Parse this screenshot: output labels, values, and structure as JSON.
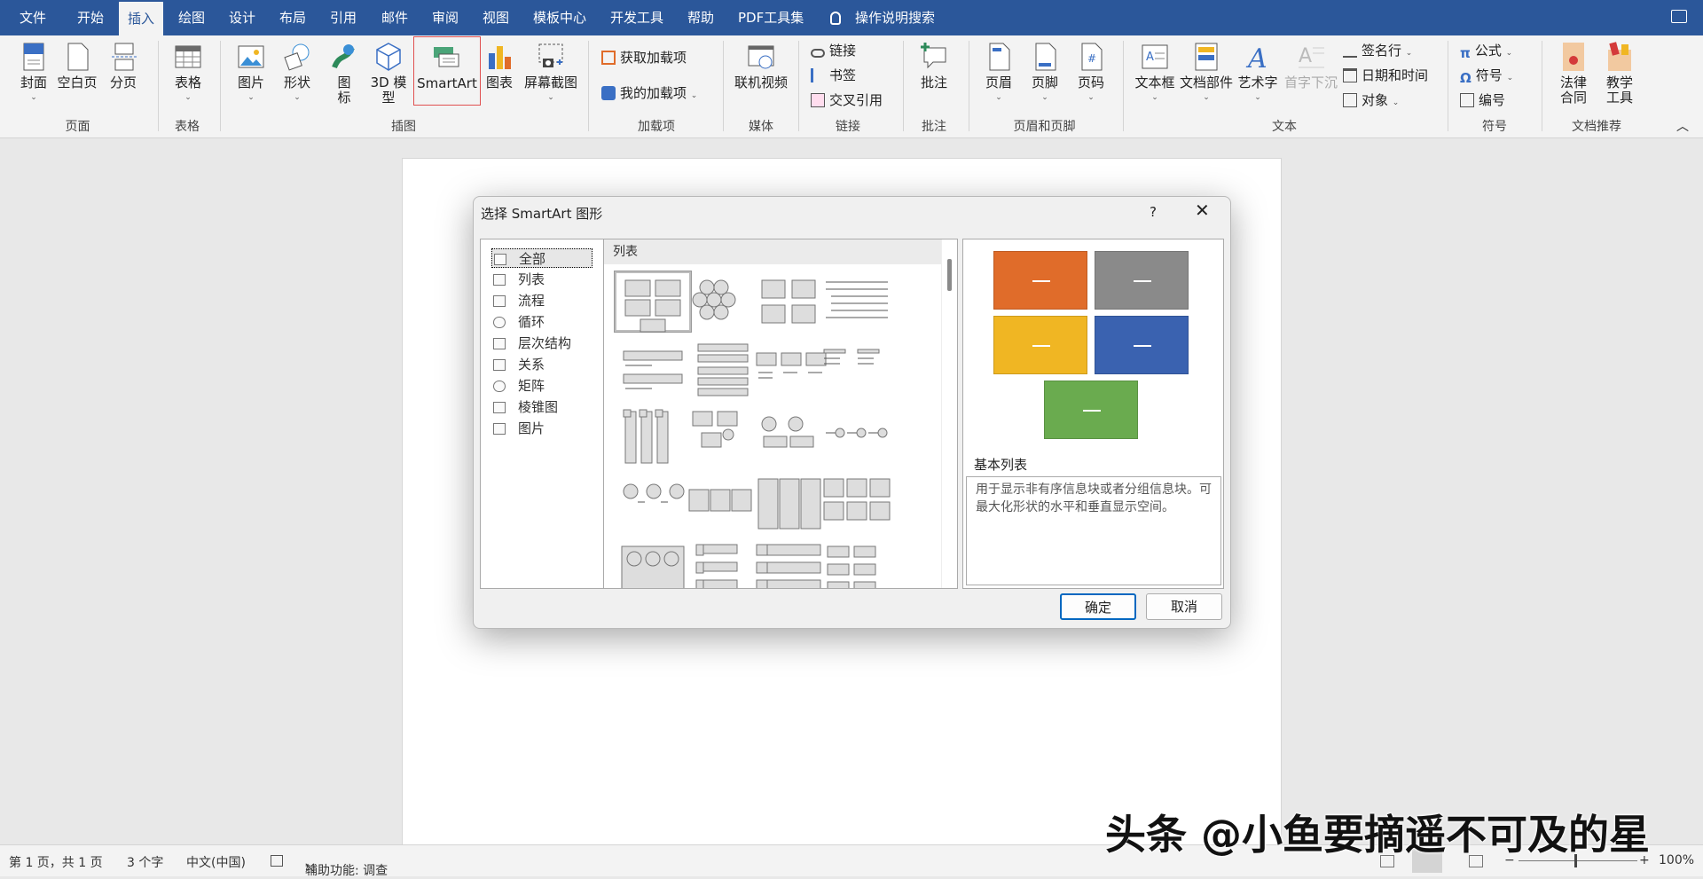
{
  "menu": {
    "tabs": [
      "文件",
      "开始",
      "插入",
      "绘图",
      "设计",
      "布局",
      "引用",
      "邮件",
      "审阅",
      "视图",
      "模板中心",
      "开发工具",
      "帮助",
      "PDF工具集"
    ],
    "active": "插入",
    "search": "操作说明搜索"
  },
  "ribbon": {
    "groups": [
      "页面",
      "表格",
      "插图",
      "加载项",
      "媒体",
      "链接",
      "批注",
      "页眉和页脚",
      "文本",
      "符号",
      "文档推荐"
    ],
    "page": {
      "cover": "封面",
      "blank": "空白页",
      "break": "分页"
    },
    "table": "表格",
    "illus": {
      "picture": "图片",
      "shape": "形状",
      "icon": "图\n标",
      "model3d": "3D 模\n型",
      "smartart": "SmartArt",
      "chart": "图表",
      "screenshot": "屏幕截图"
    },
    "addins": {
      "get": "获取加载项",
      "mine": "我的加载项"
    },
    "media": {
      "video": "联机视频"
    },
    "links": {
      "link": "链接",
      "bookmark": "书签",
      "crossref": "交叉引用"
    },
    "comment": "批注",
    "hf": {
      "header": "页眉",
      "footer": "页脚",
      "pagenum": "页码"
    },
    "text": {
      "textbox": "文本框",
      "parts": "文档部件",
      "wordart": "艺术字",
      "dropcap": "首字下沉",
      "sigline": "签名行",
      "datetime": "日期和时间",
      "object": "对象"
    },
    "symbols": {
      "equation": "公式",
      "symbol": "符号",
      "number": "编号"
    },
    "rec": {
      "legal": "法律\n合同",
      "teach": "教学\n工具"
    }
  },
  "dialog": {
    "title": "选择 SmartArt 图形",
    "help": "?",
    "close": "✕",
    "categories": [
      "全部",
      "列表",
      "流程",
      "循环",
      "层次结构",
      "关系",
      "矩阵",
      "棱锥图",
      "图片"
    ],
    "selected_category": "全部",
    "gallery_heading": "列表",
    "preview_name": "基本列表",
    "preview_desc": "用于显示非有序信息块或者分组信息块。可最大化形状的水平和垂直显示空间。",
    "preview_colors": [
      "#e06c2a",
      "#8a8a8a",
      "#f0b623",
      "#3a62b0",
      "#6aab4f"
    ],
    "ok": "确定",
    "cancel": "取消"
  },
  "status": {
    "page": "第 1 页，共 1 页",
    "words": "3 个字",
    "lang": "中文(中国)",
    "access": "辅助功能: 调查",
    "zoom": "100%"
  },
  "watermark": "头条 @小鱼要摘遥不可及的星"
}
